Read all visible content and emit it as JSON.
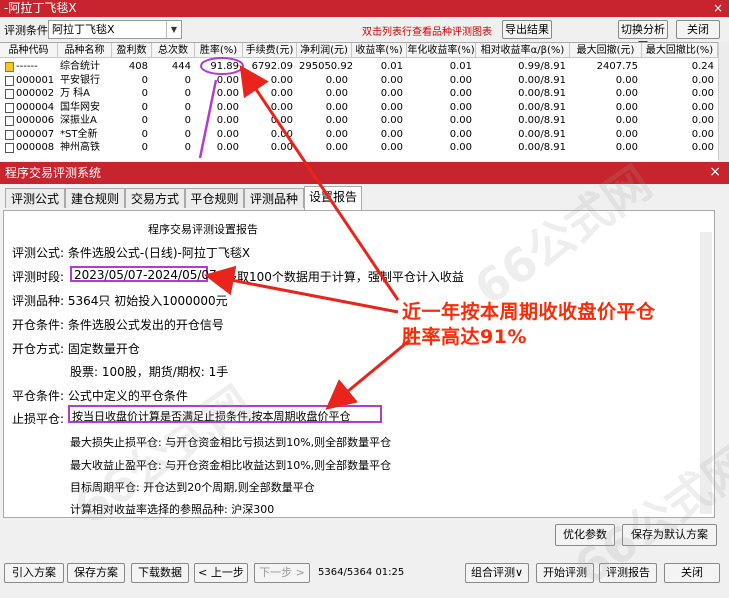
{
  "top_window": {
    "title": "-阿拉丁飞毯X",
    "close_glyph": "×",
    "formula_label": "评测条件:",
    "formula_value": "阿拉丁飞毯X",
    "hint": "双击列表行查看品种评测图表",
    "export_button": "导出结果",
    "switch_button": "切换分析图",
    "close_button": "关闭"
  },
  "grid": {
    "columns": [
      "品种代码",
      "品种名称",
      "盈利数",
      "总次数",
      "胜率(%)",
      "手续费(元)",
      "净利润(元)",
      "收益率(%)",
      "年化收益率(%)",
      "相对收益率α/β(%)",
      "最大回撤(元)",
      "最大回撤比(%)"
    ],
    "rows": [
      [
        "------",
        "综合统计",
        "408",
        "444",
        "91.89",
        "6792.09",
        "295050.92",
        "0.01",
        "0.01",
        "0.99/8.91",
        "2407.75",
        "0.24"
      ],
      [
        "000001",
        "平安银行",
        "0",
        "0",
        "0.00",
        "0.00",
        "0.00",
        "0.00",
        "0.00",
        "0.00/8.91",
        "0.00",
        "0.00"
      ],
      [
        "000002",
        "万 科A",
        "0",
        "0",
        "0.00",
        "0.00",
        "0.00",
        "0.00",
        "0.00",
        "0.00/8.91",
        "0.00",
        "0.00"
      ],
      [
        "000004",
        "国华网安",
        "0",
        "0",
        "0.00",
        "0.00",
        "0.00",
        "0.00",
        "0.00",
        "0.00/8.91",
        "0.00",
        "0.00"
      ],
      [
        "000006",
        "深振业A",
        "0",
        "0",
        "0.00",
        "0.00",
        "0.00",
        "0.00",
        "0.00",
        "0.00/8.91",
        "0.00",
        "0.00"
      ],
      [
        "000007",
        "*ST全新",
        "0",
        "0",
        "0.00",
        "0.00",
        "0.00",
        "0.00",
        "0.00",
        "0.00/8.91",
        "0.00",
        "0.00"
      ],
      [
        "000008",
        "神州高铁",
        "0",
        "0",
        "0.00",
        "0.00",
        "0.00",
        "0.00",
        "0.00",
        "0.00/8.91",
        "0.00",
        "0.00"
      ]
    ]
  },
  "bottom_window": {
    "title": "程序交易评测系统",
    "close_glyph": "×",
    "tabs": [
      "评测公式",
      "建仓规则",
      "交易方式",
      "平仓规则",
      "评测品种",
      "设置报告"
    ],
    "report_title": "程序交易评测设置报告",
    "lines": [
      "评测公式: 条件选股公式-(日线)-阿拉丁飞毯X",
      "评测时段:",
      "2023/05/07-2024/05/07",
      "多取100个数据用于计算，强制平仓计入收益",
      "评测品种: 5364只 初始投入1000000元",
      "开仓条件: 条件选股公式发出的开仓信号",
      "开仓方式: 固定数量开仓",
      "股票: 100股，期货/期权: 1手",
      "平仓条件: 公式中定义的平仓条件",
      "止损平仓:",
      "按当日收盘价计算是否满足止损条件,按本周期收盘价平仓",
      "最大损失止损平仓: 与开仓资金相比亏损达到10%,则全部数量平仓",
      "最大收益止盈平仓: 与开仓资金相比收益达到10%,则全部数量平仓",
      "目标周期平仓: 开仓达到20个周期,则全部数量平仓",
      "计算相对收益率选择的参照品种: 沪深300"
    ],
    "optimize_button": "优化参数",
    "save_default_button": "保存为默认方案",
    "footer_buttons": [
      "引入方案",
      "保存方案",
      "下载数据",
      "< 上一步",
      "下一步 >",
      "组合评测∨",
      "开始评测",
      "评测报告",
      "关闭"
    ],
    "status": "5364/5364 01:25"
  },
  "annotation": {
    "line1": "近一年按本周期收收盘价平仓",
    "line2": "胜率高达91%"
  },
  "watermark": "66公式网",
  "colors": {
    "title_bar": "#c7242e",
    "highlight_box": "#b23bd1",
    "annotation": "#fa2b06",
    "hint": "#d40000"
  }
}
